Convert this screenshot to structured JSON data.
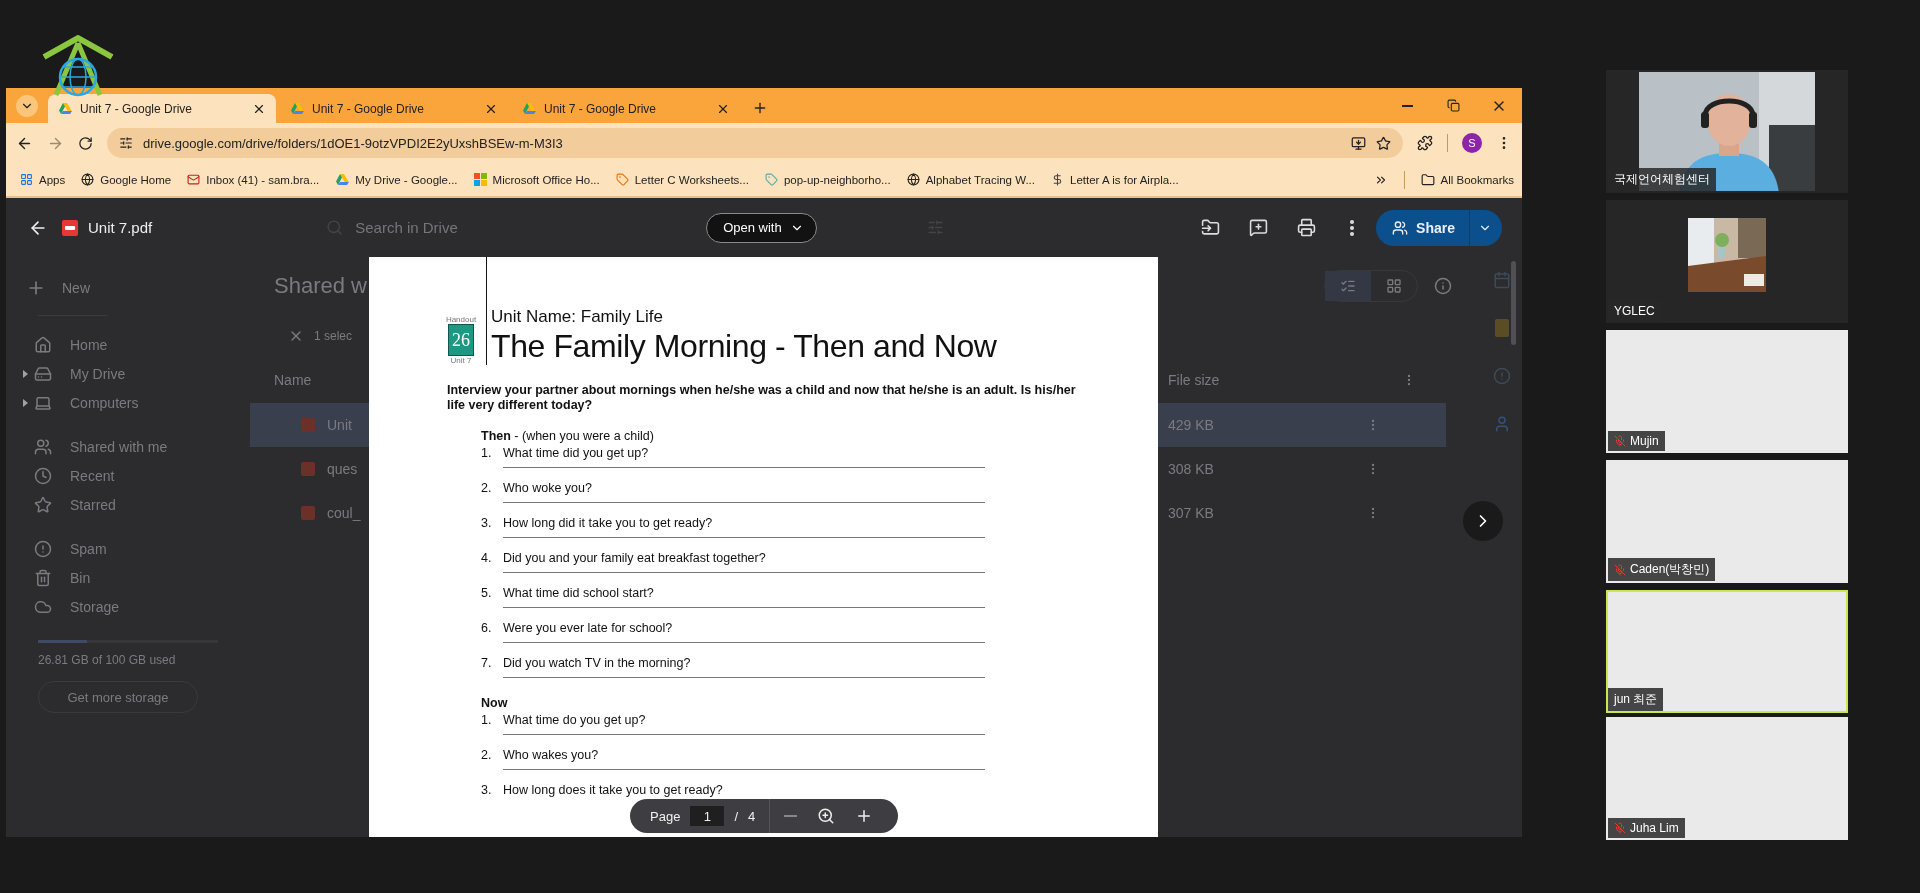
{
  "browser": {
    "tabs": [
      {
        "title": "Unit 7 - Google Drive",
        "selected": true
      },
      {
        "title": "Unit 7 - Google Drive",
        "selected": false
      },
      {
        "title": "Unit 7 - Google Drive",
        "selected": false
      }
    ],
    "url": "drive.google.com/drive/folders/1dOE1-9otzVPDI2E2yUxshBSEw-m-M3I3",
    "profile": "S",
    "bookmarks": [
      {
        "label": "Apps"
      },
      {
        "label": "Google Home"
      },
      {
        "label": "Inbox (41) - sam.bra..."
      },
      {
        "label": "My Drive - Google..."
      },
      {
        "label": "Microsoft Office Ho..."
      },
      {
        "label": "Letter C Worksheets..."
      },
      {
        "label": "pop-up-neighborho..."
      },
      {
        "label": "Alphabet Tracing W..."
      },
      {
        "label": "Letter A is for Airpla..."
      }
    ],
    "all_bookmarks": "All Bookmarks"
  },
  "drive": {
    "search": {
      "placeholder": "Search in Drive"
    },
    "sidebar": {
      "new": "New",
      "sections": [
        {
          "items": [
            {
              "label": "Home",
              "expandable": false
            },
            {
              "label": "My Drive",
              "expandable": true
            },
            {
              "label": "Computers",
              "expandable": true
            }
          ]
        },
        {
          "items": [
            {
              "label": "Shared with me",
              "expandable": false
            },
            {
              "label": "Recent",
              "expandable": false
            },
            {
              "label": "Starred",
              "expandable": false
            }
          ]
        },
        {
          "items": [
            {
              "label": "Spam",
              "expandable": false
            },
            {
              "label": "Bin",
              "expandable": false
            },
            {
              "label": "Storage",
              "expandable": false
            }
          ]
        }
      ],
      "storage": {
        "level": 0.27,
        "text": "26.81 GB of 100 GB used",
        "button": "Get more storage"
      }
    },
    "heading": "Shared w",
    "selection": "1 selec",
    "columns": {
      "name": "Name",
      "size": "File size"
    },
    "rows": [
      {
        "name": "Unit ",
        "size": "429 KB",
        "selected": true
      },
      {
        "name": "ques",
        "size": "308 KB",
        "selected": false
      },
      {
        "name": "coul_",
        "size": "307 KB",
        "selected": false
      }
    ]
  },
  "viewer": {
    "file": "Unit 7.pdf",
    "open_with": "Open with",
    "share": "Share",
    "page_nav": {
      "label": "Page",
      "current": "1",
      "separator": "/",
      "total": "4"
    },
    "document": {
      "handout_label": "Handout",
      "handout_number": "26",
      "unit_label": "Unit 7",
      "unit_name": "Unit Name: Family Life",
      "title": "The Family Morning - Then and Now",
      "instructions": "Interview your partner about mornings when he/she was a child and now that he/she is an adult. Is his/her life very different today?",
      "sections": [
        {
          "heading": "**Then** - (when you were a child)",
          "questions": [
            {
              "number": "1.",
              "text": "What time did you get up?"
            },
            {
              "number": "2.",
              "text": "Who woke you?"
            },
            {
              "number": "3.",
              "text": "How long did it take you to get ready?"
            },
            {
              "number": "4.",
              "text": "Did you and your family eat breakfast together?"
            },
            {
              "number": "5.",
              "text": "What time did school start?"
            },
            {
              "number": "6.",
              "text": "Were you ever late for school?"
            },
            {
              "number": "7.",
              "text": "Did you watch TV in the morning?"
            }
          ]
        },
        {
          "heading": "**Now**",
          "questions": [
            {
              "number": "1.",
              "text": "What time do you get up?"
            },
            {
              "number": "2.",
              "text": "Who wakes you?"
            },
            {
              "number": "3.",
              "text": "How long does it take you to get ready?"
            }
          ]
        }
      ]
    }
  },
  "participants": [
    {
      "name": "국제언어체험센터",
      "kind": "video",
      "muted": false,
      "speaking": false
    },
    {
      "name": "YGLEC",
      "muted": false,
      "speaking": false
    },
    {
      "name": "Mujin",
      "kind": "blank",
      "muted": true,
      "speaking": false
    },
    {
      "name": "Caden(박창민)",
      "kind": "blank",
      "muted": true,
      "speaking": false
    },
    {
      "name": "jun 최준",
      "kind": "blank",
      "muted": false,
      "speaking": true
    },
    {
      "name": "Juha Lim",
      "kind": "blank",
      "muted": true,
      "speaking": false
    }
  ]
}
